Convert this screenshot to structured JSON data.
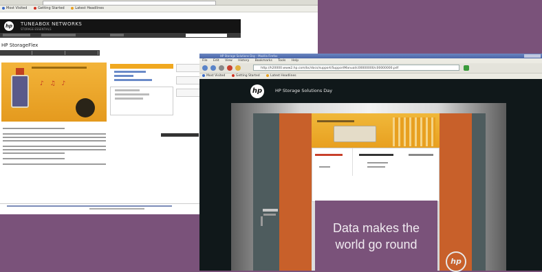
{
  "back_window": {
    "bookmarks": [
      "Most Visited",
      "Getting Started",
      "Latest Headlines"
    ],
    "site_title": "TUNEABOX NETWORKS",
    "site_subtitle": "STORAGE ESSENTIALS",
    "page_title": "HP StorageFlex"
  },
  "front_window": {
    "window_title": "HP Storage Solutions Day - Mozilla Firefox",
    "menu": [
      "File",
      "Edit",
      "View",
      "History",
      "Bookmarks",
      "Tools",
      "Help"
    ],
    "url": "http://h20000.www2.hp.com/bc/docs/support/SupportManual/c00000000/c00000000.pdf",
    "bookmarks": [
      "Most Visited",
      "Getting Started",
      "Latest Headlines"
    ],
    "hp_logo": "hp",
    "site_title": "HP Storage Solutions Day",
    "slogan_line1": "Data makes the",
    "slogan_line2": "world go round",
    "badge": "hp"
  },
  "colors": {
    "backdrop": "#7a527a",
    "hp_orange": "#c8602a",
    "hp_gold": "#f0b83a",
    "hp_dark": "#141c1c"
  }
}
